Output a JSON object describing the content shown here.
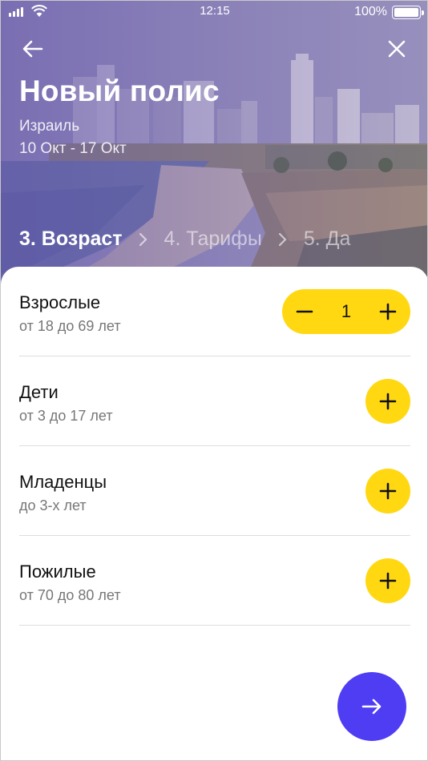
{
  "status_bar": {
    "time": "12:15",
    "battery_percent": "100%",
    "signal_icon": "signal-bars-icon",
    "wifi_icon": "wifi-icon",
    "battery_icon": "battery-icon",
    "battery_level": 1.0
  },
  "header": {
    "back_icon": "arrow-left-icon",
    "close_icon": "close-icon",
    "title": "Новый полис",
    "country": "Израиль",
    "dates": "10 Окт - 17 Окт",
    "background_image": "tel-aviv-beach-cityscape"
  },
  "steps": [
    {
      "label": "3. Возраст",
      "active": true
    },
    {
      "label": "4. Тарифы",
      "active": false
    },
    {
      "label": "5. Да",
      "active": false
    }
  ],
  "travelers": [
    {
      "label": "Взрослые",
      "range": "от 18 до 69 лет",
      "count": "1",
      "has_stepper": true
    },
    {
      "label": "Дети",
      "range": "от 3 до 17 лет",
      "has_stepper": false
    },
    {
      "label": "Младенцы",
      "range": "до 3-х лет",
      "has_stepper": false
    },
    {
      "label": "Пожилые",
      "range": "от 70 до 80 лет",
      "has_stepper": false
    }
  ],
  "next_button": {
    "icon": "arrow-right-icon"
  },
  "colors": {
    "accent_yellow": "#ffd812",
    "primary_purple": "#4f3df3",
    "hero_tint": "#7d70ad",
    "text_primary": "#111111",
    "text_secondary": "#777777"
  }
}
